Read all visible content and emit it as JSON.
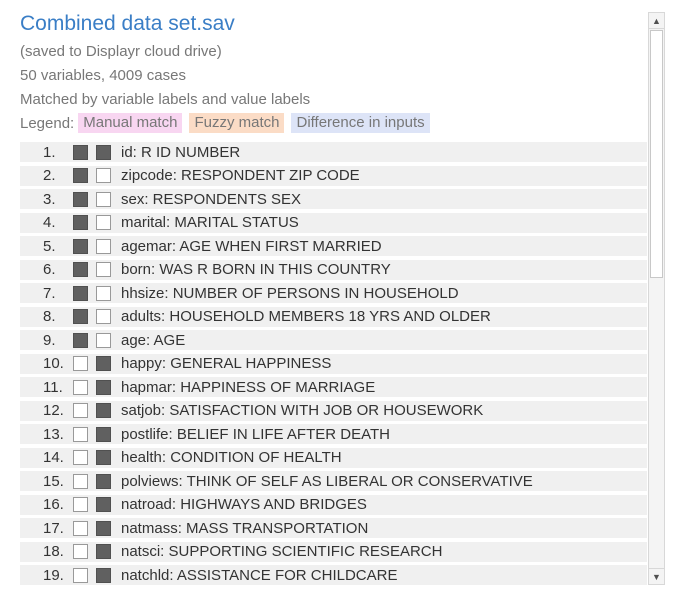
{
  "header": {
    "title": "Combined data set.sav",
    "saved_note": "(saved to Displayr cloud drive)",
    "summary": "50 variables, 4009 cases",
    "match_note": "Matched by variable labels and value labels"
  },
  "legend": {
    "label": "Legend:",
    "manual": "Manual match",
    "fuzzy": "Fuzzy match",
    "difference": "Difference in inputs",
    "colors": {
      "manual": "#f8d6f1",
      "fuzzy": "#fbdcc6",
      "difference": "#dde4f7"
    }
  },
  "rows": [
    {
      "num": "1.",
      "box1": true,
      "box2": true,
      "label": "id: R ID NUMBER"
    },
    {
      "num": "2.",
      "box1": true,
      "box2": false,
      "label": "zipcode: RESPONDENT ZIP CODE"
    },
    {
      "num": "3.",
      "box1": true,
      "box2": false,
      "label": "sex: RESPONDENTS SEX"
    },
    {
      "num": "4.",
      "box1": true,
      "box2": false,
      "label": "marital: MARITAL STATUS"
    },
    {
      "num": "5.",
      "box1": true,
      "box2": false,
      "label": "agemar: AGE WHEN FIRST MARRIED"
    },
    {
      "num": "6.",
      "box1": true,
      "box2": false,
      "label": "born: WAS R BORN IN THIS COUNTRY"
    },
    {
      "num": "7.",
      "box1": true,
      "box2": false,
      "label": "hhsize: NUMBER OF PERSONS IN HOUSEHOLD"
    },
    {
      "num": "8.",
      "box1": true,
      "box2": false,
      "label": "adults: HOUSEHOLD MEMBERS 18 YRS AND OLDER"
    },
    {
      "num": "9.",
      "box1": true,
      "box2": false,
      "label": "age: AGE"
    },
    {
      "num": "10.",
      "box1": false,
      "box2": true,
      "label": "happy: GENERAL HAPPINESS"
    },
    {
      "num": "11.",
      "box1": false,
      "box2": true,
      "label": "hapmar: HAPPINESS OF MARRIAGE"
    },
    {
      "num": "12.",
      "box1": false,
      "box2": true,
      "label": "satjob: SATISFACTION WITH JOB OR HOUSEWORK"
    },
    {
      "num": "13.",
      "box1": false,
      "box2": true,
      "label": "postlife: BELIEF IN LIFE AFTER DEATH"
    },
    {
      "num": "14.",
      "box1": false,
      "box2": true,
      "label": "health: CONDITION OF HEALTH"
    },
    {
      "num": "15.",
      "box1": false,
      "box2": true,
      "label": "polviews: THINK OF SELF AS LIBERAL OR CONSERVATIVE"
    },
    {
      "num": "16.",
      "box1": false,
      "box2": true,
      "label": "natroad: HIGHWAYS AND BRIDGES"
    },
    {
      "num": "17.",
      "box1": false,
      "box2": true,
      "label": "natmass: MASS TRANSPORTATION"
    },
    {
      "num": "18.",
      "box1": false,
      "box2": true,
      "label": "natsci: SUPPORTING SCIENTIFIC RESEARCH"
    },
    {
      "num": "19.",
      "box1": false,
      "box2": true,
      "label": "natchld: ASSISTANCE FOR CHILDCARE"
    }
  ],
  "scrollbar": {
    "up_icon": "triangle-up-icon",
    "down_icon": "triangle-down-icon"
  }
}
